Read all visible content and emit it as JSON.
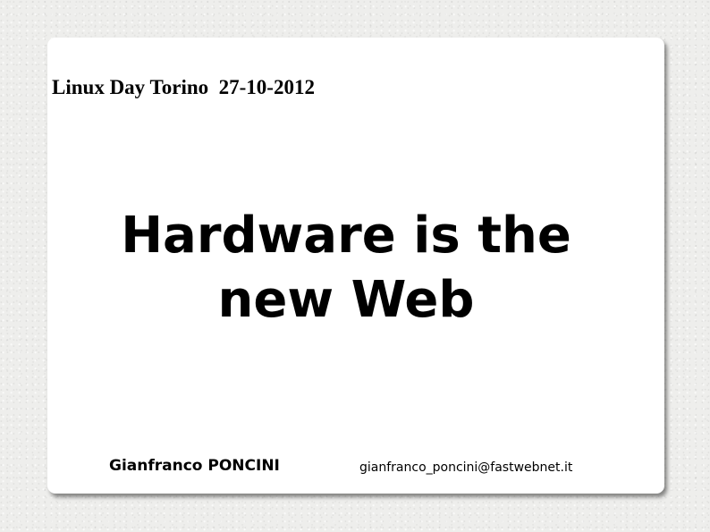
{
  "slide": {
    "event": "Linux Day Torino  27-10-2012",
    "title_lines": [
      "Hardware is the",
      "new Web"
    ],
    "author": "Gianfranco PONCINI",
    "email": "gianfranco_poncini@fastwebnet.it"
  },
  "colors": {
    "background": "#eeeeec",
    "card": "#ffffff",
    "text": "#000000"
  }
}
